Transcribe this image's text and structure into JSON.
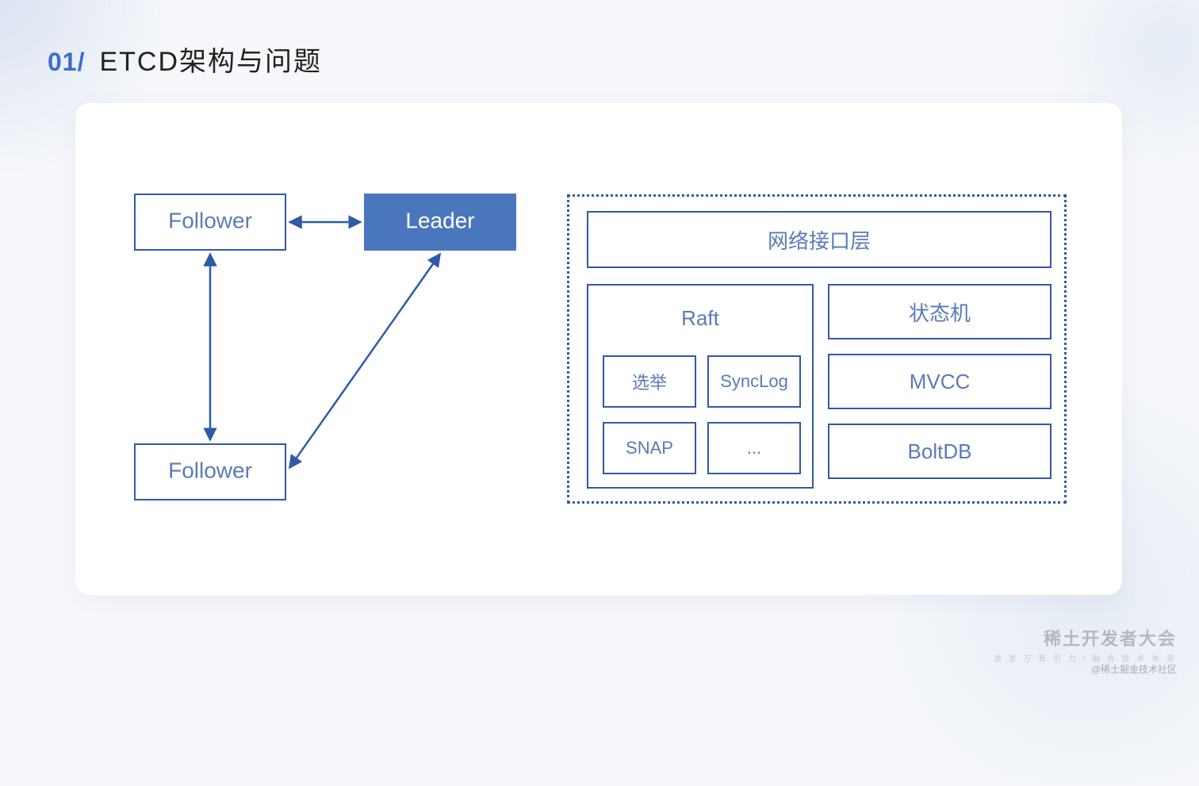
{
  "header": {
    "number": "01/",
    "title": "ETCD架构与问题"
  },
  "left_diagram": {
    "follower1": "Follower",
    "leader": "Leader",
    "follower2": "Follower"
  },
  "right_diagram": {
    "network_layer": "网络接口层",
    "raft": {
      "title": "Raft",
      "cells": [
        "选举",
        "SyncLog",
        "SNAP",
        "..."
      ]
    },
    "side": [
      "状态机",
      "MVCC",
      "BoltDB"
    ]
  },
  "footer": {
    "brand_line1": "稀土开发者大会",
    "brand_line2": "激 发 万 有 引 力 / 融 合 技 术 未 来",
    "credit": "@稀土掘金技术社区"
  }
}
